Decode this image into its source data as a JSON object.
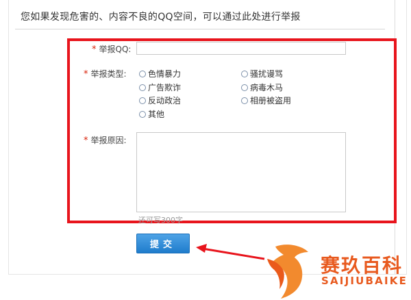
{
  "notice": "您如果发现危害的、内容不良的QQ空间，可以通过此处进行举报",
  "form": {
    "required_mark": "*",
    "qq_label": "举报QQ:",
    "qq_value": "",
    "type_label": "举报类型:",
    "type_options": [
      "色情暴力",
      "骚扰谩骂",
      "广告欺诈",
      "病毒木马",
      "反动政治",
      "相册被盗用",
      "其他"
    ],
    "reason_label": "举报原因:",
    "reason_value": "",
    "remaining_text": "还可写300字",
    "submit_label": "提交"
  },
  "watermark": {
    "brand_cn": "赛玖百科",
    "brand_en": "SAIJIUBAIKE"
  },
  "colors": {
    "highlight_box": "#e8141c",
    "submit_button": "#2b88d8",
    "watermark": "#e85a1f",
    "required_mark": "#d81e06"
  }
}
